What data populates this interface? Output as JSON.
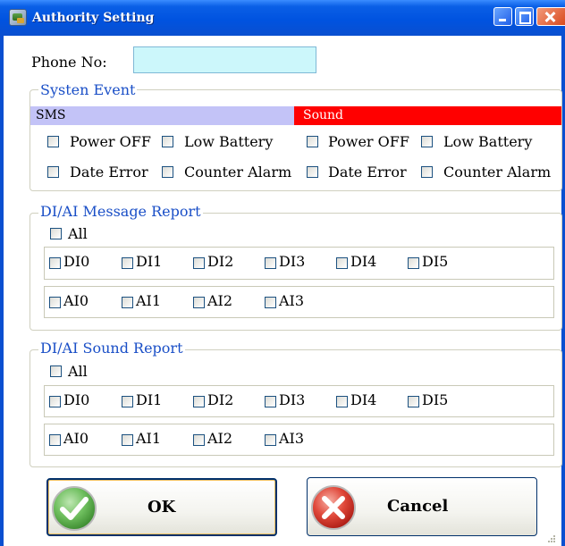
{
  "window": {
    "title": "Authority Setting"
  },
  "phone": {
    "label": "Phone No:",
    "value": ""
  },
  "system_event": {
    "legend": "Systen Event",
    "sms_header": "SMS",
    "sound_header": "Sound",
    "sms_color": "#c3c3f7",
    "sound_color": "#ff0000",
    "sms_items": [
      "Power OFF",
      "Low Battery",
      "Date Error",
      "Counter Alarm"
    ],
    "sound_items": [
      "Power OFF",
      "Low Battery",
      "Date Error",
      "Counter Alarm"
    ]
  },
  "message_report": {
    "legend": "DI/AI Message Report",
    "all_label": "All",
    "di": [
      "DI0",
      "DI1",
      "DI2",
      "DI3",
      "DI4",
      "DI5"
    ],
    "ai": [
      "AI0",
      "AI1",
      "AI2",
      "AI3"
    ]
  },
  "sound_report": {
    "legend": "DI/AI Sound Report",
    "all_label": "All",
    "di": [
      "DI0",
      "DI1",
      "DI2",
      "DI3",
      "DI4",
      "DI5"
    ],
    "ai": [
      "AI0",
      "AI1",
      "AI2",
      "AI3"
    ]
  },
  "buttons": {
    "ok": "OK",
    "cancel": "Cancel"
  },
  "icons": {
    "app": "app-icon",
    "minimize": "minimize-icon",
    "maximize": "maximize-icon",
    "close": "close-icon",
    "ok": "green-check-icon",
    "cancel": "red-x-icon"
  }
}
